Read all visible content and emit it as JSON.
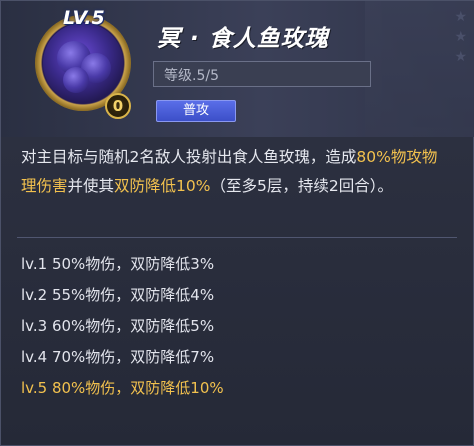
{
  "skill": {
    "level_badge": "LV.5",
    "cost": "0",
    "name": "冥 · 食人鱼玫瑰",
    "level_text": "等级.5/5",
    "type_tag": "普攻"
  },
  "description": {
    "part1": "对主目标与随机2名敌人投射出食人鱼玫瑰，造成",
    "highlight1": "80%物攻物理伤害",
    "part2": "并使其",
    "highlight2": "双防降低10%",
    "part3": "（至多5层，持续2回合）。"
  },
  "levels": [
    {
      "text": "lv.1 50%物伤，双防降低3%",
      "active": false
    },
    {
      "text": "lv.2 55%物伤，双防降低4%",
      "active": false
    },
    {
      "text": "lv.3 60%物伤，双防降低5%",
      "active": false
    },
    {
      "text": "lv.4 70%物伤，双防降低7%",
      "active": false
    },
    {
      "text": "lv.5 80%物伤，双防降低10%",
      "active": true
    }
  ],
  "colors": {
    "highlight": "#f2c14e",
    "type_tag": "#4a5ed8",
    "text": "#e6e8ef"
  }
}
